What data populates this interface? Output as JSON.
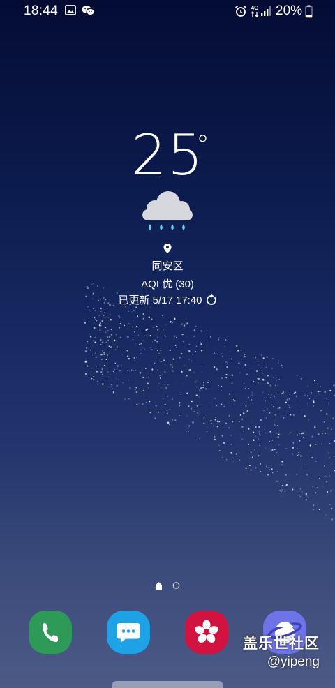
{
  "status_bar": {
    "time": "18:44",
    "network": "4G",
    "battery_percent": "20%",
    "icons": [
      "gallery-icon",
      "wechat-icon",
      "alarm-icon",
      "network-4g-icon",
      "signal-icon",
      "battery-icon"
    ]
  },
  "weather": {
    "temperature": "25",
    "degree_symbol": "°",
    "condition_icon": "rain-cloud-icon",
    "location": "同安区",
    "aqi": "AQI 优 (30)",
    "updated": "已更新 5/17 17:40"
  },
  "home": {
    "page_count": 2,
    "current_page": 1
  },
  "dock": {
    "apps": [
      {
        "icon": "phone-icon",
        "color": "#2d9a58"
      },
      {
        "icon": "messages-icon",
        "color": "#1ea2e6"
      },
      {
        "icon": "gallery-flower-icon",
        "color": "#d2133f"
      },
      {
        "icon": "internet-icon",
        "color": "#6e73e8"
      }
    ]
  },
  "watermark": {
    "line1": "盖乐世社区",
    "line2": "@yipeng"
  }
}
